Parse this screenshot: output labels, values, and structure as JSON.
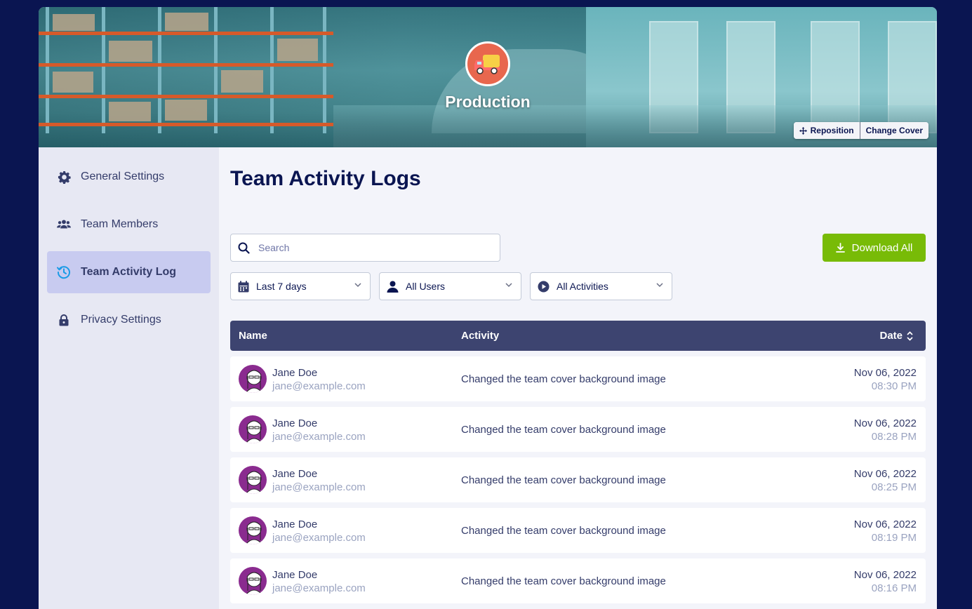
{
  "team": {
    "name": "Production",
    "cover_actions": {
      "reposition": "Reposition",
      "change_cover": "Change Cover"
    }
  },
  "sidebar": {
    "items": [
      {
        "label": "General Settings",
        "icon": "gear-icon",
        "active": false
      },
      {
        "label": "Team Members",
        "icon": "users-icon",
        "active": false
      },
      {
        "label": "Team Activity Log",
        "icon": "history-icon",
        "active": true
      },
      {
        "label": "Privacy Settings",
        "icon": "lock-icon",
        "active": false
      }
    ]
  },
  "main": {
    "title": "Team Activity Logs",
    "search": {
      "placeholder": "Search",
      "value": ""
    },
    "download_label": "Download All",
    "filters": {
      "date": "Last 7 days",
      "users": "All Users",
      "activities": "All Activities"
    },
    "table": {
      "headers": {
        "name": "Name",
        "activity": "Activity",
        "date": "Date"
      },
      "rows": [
        {
          "name": "Jane Doe",
          "email": "jane@example.com",
          "activity": "Changed the team cover background image",
          "date": "Nov 06, 2022",
          "time": "08:30 PM"
        },
        {
          "name": "Jane Doe",
          "email": "jane@example.com",
          "activity": "Changed the team cover background image",
          "date": "Nov 06, 2022",
          "time": "08:28 PM"
        },
        {
          "name": "Jane Doe",
          "email": "jane@example.com",
          "activity": "Changed the team cover background image",
          "date": "Nov 06, 2022",
          "time": "08:25 PM"
        },
        {
          "name": "Jane Doe",
          "email": "jane@example.com",
          "activity": "Changed the team cover background image",
          "date": "Nov 06, 2022",
          "time": "08:19 PM"
        },
        {
          "name": "Jane Doe",
          "email": "jane@example.com",
          "activity": "Changed the team cover background image",
          "date": "Nov 06, 2022",
          "time": "08:16 PM"
        }
      ]
    }
  },
  "colors": {
    "page_bg": "#0a1551",
    "accent_green": "#78bb07",
    "table_header": "#3d4470",
    "sidebar_active": "#c8cbf0",
    "team_avatar": "#e8674e"
  }
}
